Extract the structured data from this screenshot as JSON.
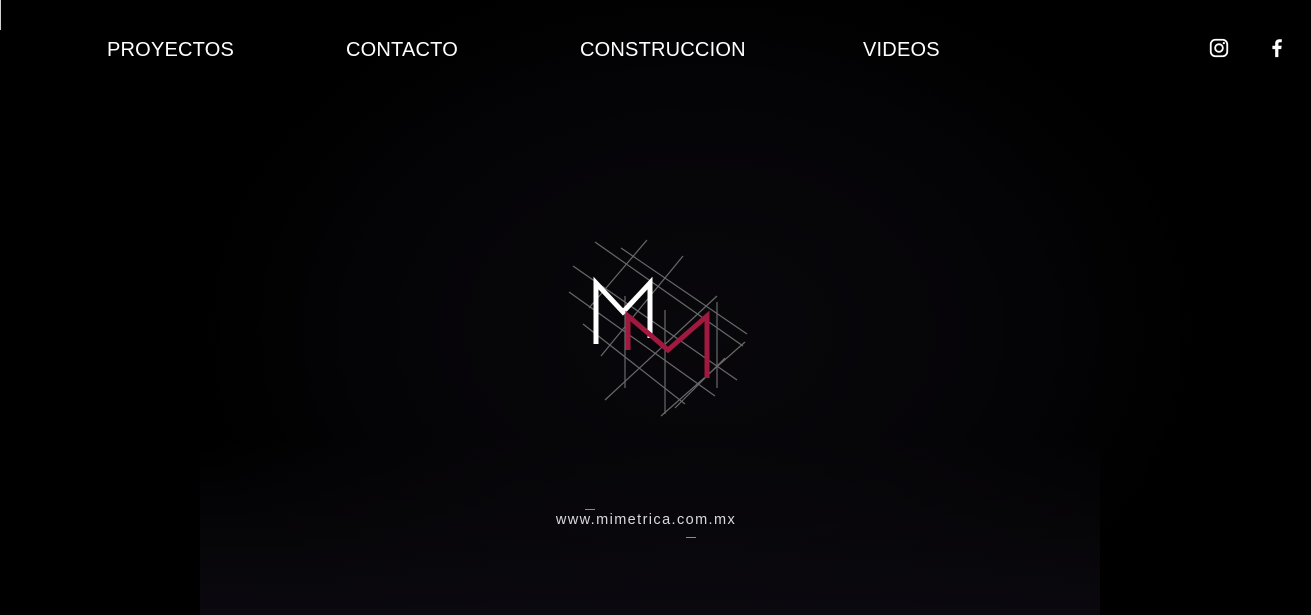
{
  "nav": {
    "items": [
      {
        "label": "PROYECTOS"
      },
      {
        "label": "CONTACTO"
      },
      {
        "label": "CONSTRUCCION"
      },
      {
        "label": "VIDEOS"
      }
    ]
  },
  "social": {
    "instagram_icon": "instagram-icon",
    "facebook_icon": "facebook-icon"
  },
  "hero": {
    "logo_icon": "mm-logo",
    "logo_colors": {
      "primary": "#ffffff",
      "accent": "#a1193f",
      "grid": "#7a7a7a"
    },
    "url_text": "www.mimetrica.com.mx"
  }
}
